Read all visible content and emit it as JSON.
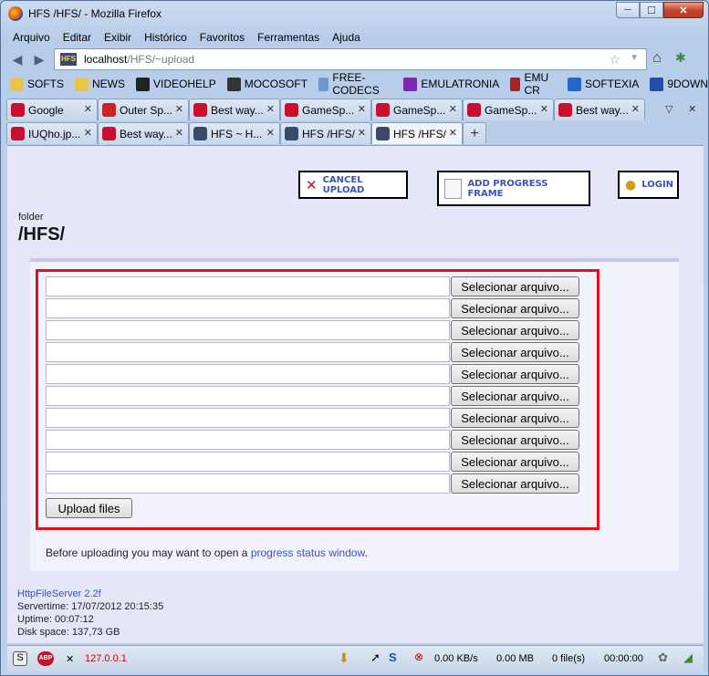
{
  "window": {
    "title": "HFS /HFS/ - Mozilla Firefox",
    "controls": {
      "minimize": "─",
      "maximize": "☐",
      "close": "✕"
    }
  },
  "menu": [
    {
      "label": "Arquivo"
    },
    {
      "label": "Editar"
    },
    {
      "label": "Exibir"
    },
    {
      "label": "Histórico"
    },
    {
      "label": "Favoritos"
    },
    {
      "label": "Ferramentas"
    },
    {
      "label": "Ajuda"
    }
  ],
  "nav": {
    "back_icon": "◀",
    "forward_icon": "▶",
    "url_host": "localhost",
    "url_path": "/HFS/~upload",
    "site_icon_text": "HFS"
  },
  "bookmarks": [
    {
      "label": "SOFTS",
      "color": "#e8c44a"
    },
    {
      "label": "NEWS",
      "color": "#e8c44a"
    },
    {
      "label": "VIDEOHELP",
      "color": "#222222"
    },
    {
      "label": "MOCOSOFT",
      "color": "#333333"
    },
    {
      "label": "FREE-CODECS",
      "color": "#6a9ad6"
    },
    {
      "label": "EMULATRONIA",
      "color": "#7a2ab0"
    },
    {
      "label": "EMU CR",
      "color": "#aa2222"
    },
    {
      "label": "SOFTEXIA",
      "color": "#2266cc"
    },
    {
      "label": "9DOWN",
      "color": "#1f4fa8"
    }
  ],
  "tabs_row1": [
    {
      "label": "Google",
      "color": "#c8102e"
    },
    {
      "label": "Outer Sp...",
      "color": "#cc2222"
    },
    {
      "label": "Best way...",
      "color": "#c8102e"
    },
    {
      "label": "GameSp...",
      "color": "#c8102e"
    },
    {
      "label": "GameSp...",
      "color": "#c8102e"
    },
    {
      "label": "GameSp...",
      "color": "#c8102e"
    },
    {
      "label": "Best way...",
      "color": "#c8102e"
    }
  ],
  "tabs_row2": [
    {
      "label": "IUQho.jp...",
      "color": "#c8102e"
    },
    {
      "label": "Best way...",
      "color": "#c8102e"
    },
    {
      "label": "HFS ~ H...",
      "color": "#3a4a6b"
    },
    {
      "label": "HFS /HFS/",
      "color": "#3a4a6b"
    },
    {
      "label": "HFS /HFS/",
      "color": "#3a4a6b",
      "active": true
    }
  ],
  "page": {
    "cancel_upload": "CANCEL UPLOAD",
    "add_progress_frame": "ADD PROGRESS FRAME",
    "login": "LOGIN",
    "folder_label": "folder",
    "folder_name": "/HFS/",
    "select_file_label": "Selecionar arquivo...",
    "upload_label": "Upload files",
    "before_text": "Before uploading you may want to open a ",
    "progress_link": "progress status window",
    "before_end": "."
  },
  "footer": {
    "server": "HttpFileServer 2.2f",
    "servertime": "Servertime: 17/07/2012 20:15:35",
    "uptime": "Uptime: 00:07:12",
    "diskspace": "Disk space: 137,73 GB"
  },
  "status": {
    "abp": "ABP",
    "ip": "127.0.0.1",
    "speed": "0.00 KB/s",
    "size": "0.00 MB",
    "files": "0 file(s)",
    "time": "00:00:00",
    "accent": "#cc0000"
  }
}
